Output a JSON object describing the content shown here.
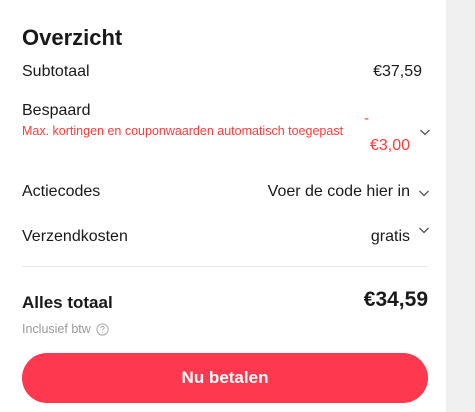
{
  "summary": {
    "title": "Overzicht",
    "subtotal": {
      "label": "Subtotaal",
      "value": "€37,59"
    },
    "savings": {
      "label": "Bespaard",
      "note": "Max. kortingen en couponwaarden automatisch toegepast",
      "value_sign": "-",
      "value": "€3,00"
    },
    "promo": {
      "label": "Actiecodes",
      "placeholder": "Voer de code hier in"
    },
    "shipping": {
      "label": "Verzendkosten",
      "value": "gratis"
    },
    "total": {
      "label": "Alles totaal",
      "value": "€34,59",
      "vat_note": "Inclusief btw"
    },
    "pay_button": "Nu betalen"
  },
  "colors": {
    "accent": "#fd384f",
    "discount_text": "#ff3b3b",
    "muted": "#999999",
    "panel": "#ffffff",
    "background": "#f0f0f0"
  },
  "icons": [
    "chevron-down-icon",
    "help-circle-icon"
  ]
}
